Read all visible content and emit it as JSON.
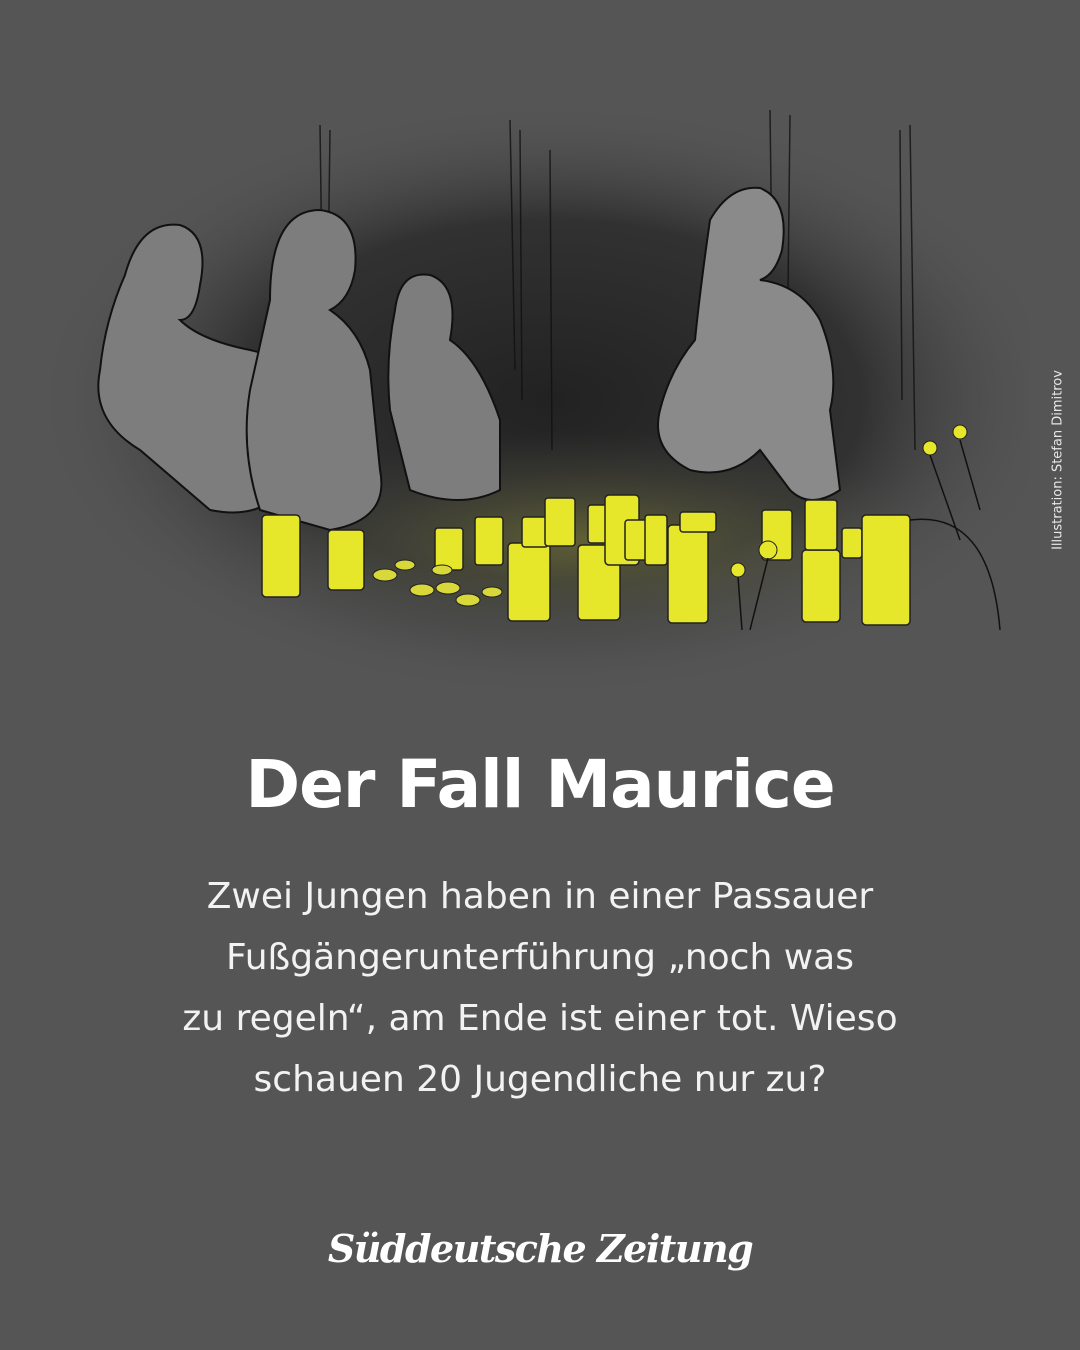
{
  "illustration": {
    "credit": "Illustration: Stefan Dimitrov",
    "colors": {
      "background": "#555555",
      "glow": "#e6e62a",
      "shadow": "#2a2a2a",
      "figure": "#7a7a7a"
    }
  },
  "headline": "Der Fall Maurice",
  "dek_lines": [
    "Zwei Jungen haben in einer Passauer",
    "Fußgängerunterführung „noch was",
    "zu regeln“, am Ende ist einer tot. Wieso",
    "schauen 20 Jugendliche nur zu?"
  ],
  "brand": "Süddeutsche Zeitung"
}
